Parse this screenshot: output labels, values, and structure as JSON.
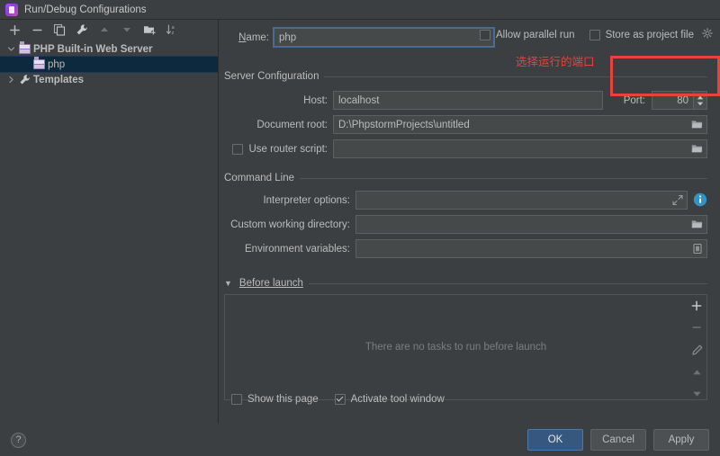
{
  "window": {
    "title": "Run/Debug Configurations",
    "icon": "phpstorm-app-icon"
  },
  "toolbar": {
    "buttons": [
      {
        "name": "add",
        "icon": "plus-icon",
        "label": "+"
      },
      {
        "name": "remove",
        "icon": "minus-icon",
        "label": "−"
      },
      {
        "name": "copy",
        "icon": "copy-icon",
        "label": "Copy"
      },
      {
        "name": "edit-templates",
        "icon": "wrench-icon",
        "label": "Edit Templates"
      },
      {
        "name": "move-up",
        "icon": "arrow-up-icon",
        "label": "Move Up"
      },
      {
        "name": "move-down",
        "icon": "arrow-down-icon",
        "label": "Move Down"
      },
      {
        "name": "move-into-folder",
        "icon": "folder-add-icon",
        "label": "Move into new folder"
      },
      {
        "name": "sort",
        "icon": "sort-az-icon",
        "label": "Sort configurations"
      }
    ]
  },
  "tree": {
    "items": [
      {
        "label": "PHP Built-in Web Server",
        "level": 1,
        "expanded": true,
        "icon": "server-icon",
        "selected": false,
        "bold": true
      },
      {
        "label": "php",
        "level": 2,
        "expanded": null,
        "icon": "server-icon",
        "selected": true,
        "bold": false
      },
      {
        "label": "Templates",
        "level": 1,
        "expanded": false,
        "icon": "wrench-icon",
        "selected": false,
        "bold": true
      }
    ]
  },
  "form": {
    "name_label": "Name:",
    "name_value": "php",
    "allow_parallel_run": {
      "label": "Allow parallel run",
      "checked": false
    },
    "store_as_project_file": {
      "label": "Store as project file",
      "checked": false,
      "gear_icon": "gear-icon"
    },
    "server_section": {
      "title": "Server Configuration",
      "host_label": "Host:",
      "host_value": "localhost",
      "port_label": "Port:",
      "port_value": "80",
      "document_root_label": "Document root:",
      "document_root_value": "D:\\PhpstormProjects\\untitled",
      "document_root_browse_icon": "folder-icon",
      "use_router_script": {
        "label": "Use router script:",
        "checked": false,
        "value": "",
        "browse_icon": "folder-icon"
      }
    },
    "command_line_section": {
      "title": "Command Line",
      "interpreter_options_label": "Interpreter options:",
      "interpreter_options_value": "",
      "interpreter_expand_icon": "expand-icon",
      "interpreter_info_icon": "info-icon",
      "custom_working_directory_label": "Custom working directory:",
      "custom_working_directory_value": "",
      "custom_working_directory_browse_icon": "folder-icon",
      "environment_variables_label": "Environment variables:",
      "environment_variables_value": "",
      "environment_variables_browse_icon": "list-icon"
    },
    "before_launch": {
      "title": "Before launch",
      "expanded": true,
      "empty_text": "There are no tasks to run before launch",
      "side_buttons": [
        {
          "name": "add-task",
          "icon": "plus-icon"
        },
        {
          "name": "remove-task",
          "icon": "minus-icon"
        },
        {
          "name": "edit-task",
          "icon": "pencil-icon"
        },
        {
          "name": "move-task-up",
          "icon": "arrow-up-icon"
        },
        {
          "name": "move-task-down",
          "icon": "arrow-down-icon"
        }
      ]
    },
    "show_this_page": {
      "label": "Show this page",
      "checked": false
    },
    "activate_tool_window": {
      "label": "Activate tool window",
      "checked": true
    }
  },
  "footer": {
    "help_label": "?",
    "ok_label": "OK",
    "cancel_label": "Cancel",
    "apply_label": "Apply"
  },
  "annotation": {
    "text": "选择运行的端口",
    "color": "#e8423a"
  },
  "colors": {
    "window_bg": "#3c3f41",
    "field_bg": "#45494a",
    "selection_blue": "#0d293e",
    "primary_button": "#365880",
    "accent_info": "#3592c4",
    "annotation_red": "#e8423a"
  }
}
